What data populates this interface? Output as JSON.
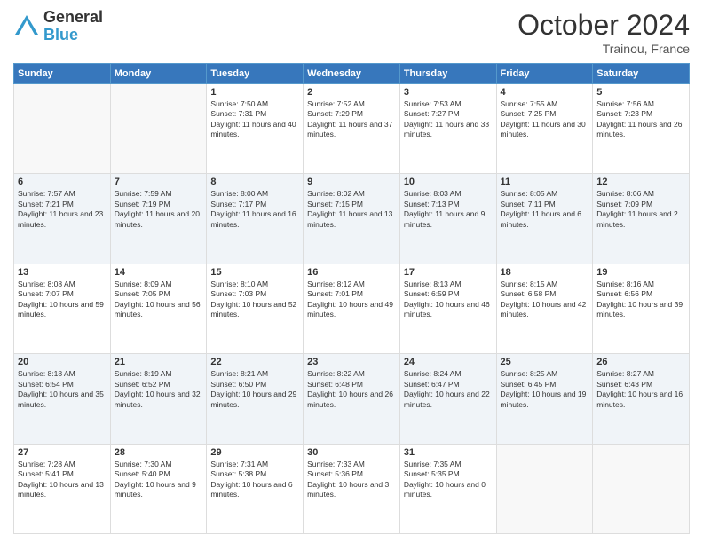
{
  "header": {
    "logo_general": "General",
    "logo_blue": "Blue",
    "month_title": "October 2024",
    "location": "Trainou, France"
  },
  "weekdays": [
    "Sunday",
    "Monday",
    "Tuesday",
    "Wednesday",
    "Thursday",
    "Friday",
    "Saturday"
  ],
  "weeks": [
    [
      {
        "day": "",
        "sunrise": "",
        "sunset": "",
        "daylight": ""
      },
      {
        "day": "",
        "sunrise": "",
        "sunset": "",
        "daylight": ""
      },
      {
        "day": "1",
        "sunrise": "Sunrise: 7:50 AM",
        "sunset": "Sunset: 7:31 PM",
        "daylight": "Daylight: 11 hours and 40 minutes."
      },
      {
        "day": "2",
        "sunrise": "Sunrise: 7:52 AM",
        "sunset": "Sunset: 7:29 PM",
        "daylight": "Daylight: 11 hours and 37 minutes."
      },
      {
        "day": "3",
        "sunrise": "Sunrise: 7:53 AM",
        "sunset": "Sunset: 7:27 PM",
        "daylight": "Daylight: 11 hours and 33 minutes."
      },
      {
        "day": "4",
        "sunrise": "Sunrise: 7:55 AM",
        "sunset": "Sunset: 7:25 PM",
        "daylight": "Daylight: 11 hours and 30 minutes."
      },
      {
        "day": "5",
        "sunrise": "Sunrise: 7:56 AM",
        "sunset": "Sunset: 7:23 PM",
        "daylight": "Daylight: 11 hours and 26 minutes."
      }
    ],
    [
      {
        "day": "6",
        "sunrise": "Sunrise: 7:57 AM",
        "sunset": "Sunset: 7:21 PM",
        "daylight": "Daylight: 11 hours and 23 minutes."
      },
      {
        "day": "7",
        "sunrise": "Sunrise: 7:59 AM",
        "sunset": "Sunset: 7:19 PM",
        "daylight": "Daylight: 11 hours and 20 minutes."
      },
      {
        "day": "8",
        "sunrise": "Sunrise: 8:00 AM",
        "sunset": "Sunset: 7:17 PM",
        "daylight": "Daylight: 11 hours and 16 minutes."
      },
      {
        "day": "9",
        "sunrise": "Sunrise: 8:02 AM",
        "sunset": "Sunset: 7:15 PM",
        "daylight": "Daylight: 11 hours and 13 minutes."
      },
      {
        "day": "10",
        "sunrise": "Sunrise: 8:03 AM",
        "sunset": "Sunset: 7:13 PM",
        "daylight": "Daylight: 11 hours and 9 minutes."
      },
      {
        "day": "11",
        "sunrise": "Sunrise: 8:05 AM",
        "sunset": "Sunset: 7:11 PM",
        "daylight": "Daylight: 11 hours and 6 minutes."
      },
      {
        "day": "12",
        "sunrise": "Sunrise: 8:06 AM",
        "sunset": "Sunset: 7:09 PM",
        "daylight": "Daylight: 11 hours and 2 minutes."
      }
    ],
    [
      {
        "day": "13",
        "sunrise": "Sunrise: 8:08 AM",
        "sunset": "Sunset: 7:07 PM",
        "daylight": "Daylight: 10 hours and 59 minutes."
      },
      {
        "day": "14",
        "sunrise": "Sunrise: 8:09 AM",
        "sunset": "Sunset: 7:05 PM",
        "daylight": "Daylight: 10 hours and 56 minutes."
      },
      {
        "day": "15",
        "sunrise": "Sunrise: 8:10 AM",
        "sunset": "Sunset: 7:03 PM",
        "daylight": "Daylight: 10 hours and 52 minutes."
      },
      {
        "day": "16",
        "sunrise": "Sunrise: 8:12 AM",
        "sunset": "Sunset: 7:01 PM",
        "daylight": "Daylight: 10 hours and 49 minutes."
      },
      {
        "day": "17",
        "sunrise": "Sunrise: 8:13 AM",
        "sunset": "Sunset: 6:59 PM",
        "daylight": "Daylight: 10 hours and 46 minutes."
      },
      {
        "day": "18",
        "sunrise": "Sunrise: 8:15 AM",
        "sunset": "Sunset: 6:58 PM",
        "daylight": "Daylight: 10 hours and 42 minutes."
      },
      {
        "day": "19",
        "sunrise": "Sunrise: 8:16 AM",
        "sunset": "Sunset: 6:56 PM",
        "daylight": "Daylight: 10 hours and 39 minutes."
      }
    ],
    [
      {
        "day": "20",
        "sunrise": "Sunrise: 8:18 AM",
        "sunset": "Sunset: 6:54 PM",
        "daylight": "Daylight: 10 hours and 35 minutes."
      },
      {
        "day": "21",
        "sunrise": "Sunrise: 8:19 AM",
        "sunset": "Sunset: 6:52 PM",
        "daylight": "Daylight: 10 hours and 32 minutes."
      },
      {
        "day": "22",
        "sunrise": "Sunrise: 8:21 AM",
        "sunset": "Sunset: 6:50 PM",
        "daylight": "Daylight: 10 hours and 29 minutes."
      },
      {
        "day": "23",
        "sunrise": "Sunrise: 8:22 AM",
        "sunset": "Sunset: 6:48 PM",
        "daylight": "Daylight: 10 hours and 26 minutes."
      },
      {
        "day": "24",
        "sunrise": "Sunrise: 8:24 AM",
        "sunset": "Sunset: 6:47 PM",
        "daylight": "Daylight: 10 hours and 22 minutes."
      },
      {
        "day": "25",
        "sunrise": "Sunrise: 8:25 AM",
        "sunset": "Sunset: 6:45 PM",
        "daylight": "Daylight: 10 hours and 19 minutes."
      },
      {
        "day": "26",
        "sunrise": "Sunrise: 8:27 AM",
        "sunset": "Sunset: 6:43 PM",
        "daylight": "Daylight: 10 hours and 16 minutes."
      }
    ],
    [
      {
        "day": "27",
        "sunrise": "Sunrise: 7:28 AM",
        "sunset": "Sunset: 5:41 PM",
        "daylight": "Daylight: 10 hours and 13 minutes."
      },
      {
        "day": "28",
        "sunrise": "Sunrise: 7:30 AM",
        "sunset": "Sunset: 5:40 PM",
        "daylight": "Daylight: 10 hours and 9 minutes."
      },
      {
        "day": "29",
        "sunrise": "Sunrise: 7:31 AM",
        "sunset": "Sunset: 5:38 PM",
        "daylight": "Daylight: 10 hours and 6 minutes."
      },
      {
        "day": "30",
        "sunrise": "Sunrise: 7:33 AM",
        "sunset": "Sunset: 5:36 PM",
        "daylight": "Daylight: 10 hours and 3 minutes."
      },
      {
        "day": "31",
        "sunrise": "Sunrise: 7:35 AM",
        "sunset": "Sunset: 5:35 PM",
        "daylight": "Daylight: 10 hours and 0 minutes."
      },
      {
        "day": "",
        "sunrise": "",
        "sunset": "",
        "daylight": ""
      },
      {
        "day": "",
        "sunrise": "",
        "sunset": "",
        "daylight": ""
      }
    ]
  ]
}
